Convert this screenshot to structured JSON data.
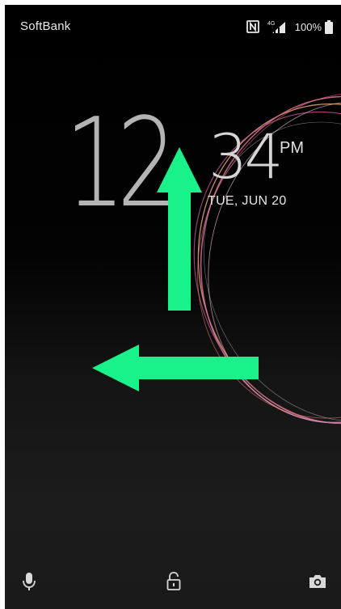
{
  "status_bar": {
    "carrier": "SoftBank",
    "nfc_icon": "nfc-icon",
    "network_label": "4G",
    "signal_icon": "cellular-signal-icon",
    "battery_percent": "100%",
    "battery_icon": "battery-full-icon"
  },
  "clock": {
    "hours": "12",
    "minutes": "34",
    "ampm": "PM",
    "date": "TUE, JUN 20"
  },
  "gesture_hints": {
    "up_arrow_icon": "swipe-up-arrow-icon",
    "left_arrow_icon": "swipe-left-arrow-icon",
    "arrow_color": "#19f28a"
  },
  "bottom_shortcuts": {
    "voice_icon": "microphone-icon",
    "unlock_icon": "unlock-padlock-icon",
    "camera_icon": "camera-icon"
  },
  "colors": {
    "background": "#000000",
    "text": "#e6e6e6",
    "ring_pink": "#d36a9a",
    "ring_orange": "#f0a870",
    "ring_white": "#ffffff"
  }
}
